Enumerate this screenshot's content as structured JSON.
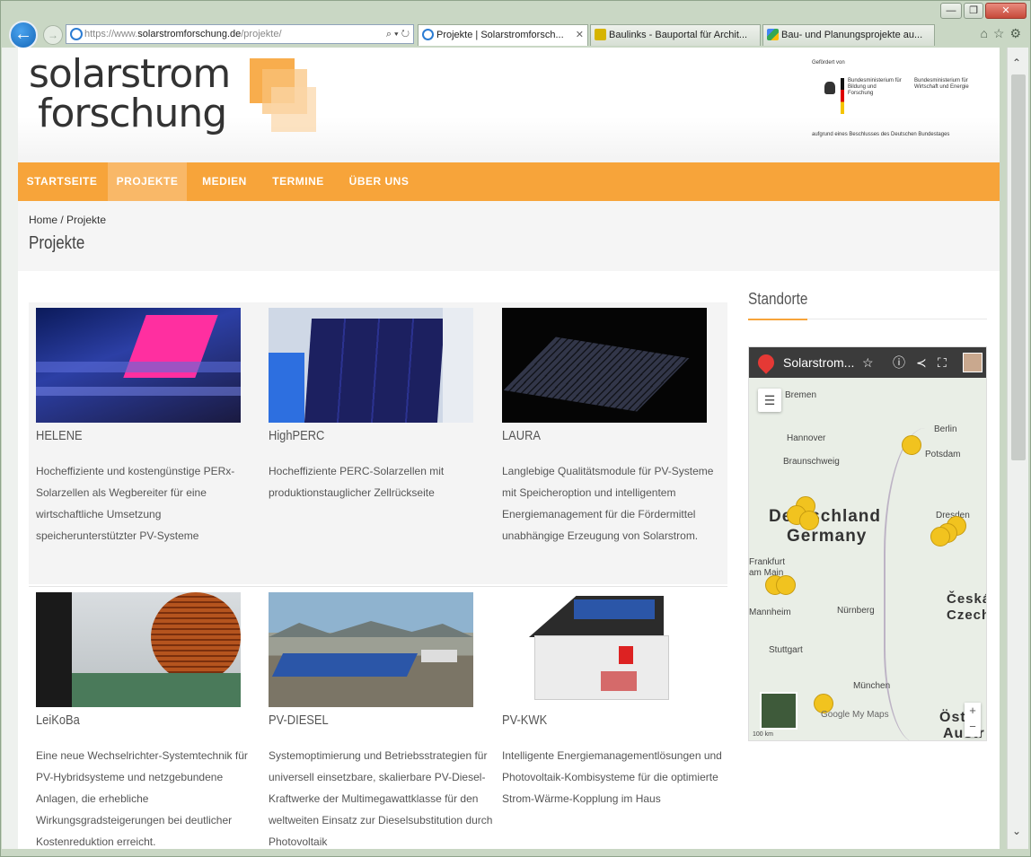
{
  "browser": {
    "address": {
      "scheme": "https://www.",
      "host": "solarstromforschung.de",
      "path": "/projekte/",
      "tools": "⌕ ▾ ↻"
    },
    "tabs": [
      {
        "label": "Projekte | Solarstromforsch...",
        "close": "✕",
        "color": "#2b7cd3"
      },
      {
        "label": "Baulinks - Bauportal für Archit...",
        "color": "#d6b400"
      },
      {
        "label": "Bau- und Planungsprojekte au...",
        "color": "#3c7a2e"
      }
    ],
    "window_buttons": {
      "minimize": "—",
      "restore": "❐",
      "close": "✕"
    },
    "back": "←",
    "forward": "→",
    "right_icons": "⌂☆⚙"
  },
  "header": {
    "logo_line1": "solarstrom",
    "logo_line2": "forschung",
    "sponsor": {
      "caption": "Gefördert von",
      "ministry1": "Bundesministerium für Bildung und Forschung",
      "ministry2": "Bundesministerium für Wirtschaft und Energie",
      "note": "aufgrund eines Beschlusses des Deutschen Bundestages"
    }
  },
  "nav": {
    "items": [
      {
        "label": "STARTSEITE"
      },
      {
        "label": "PROJEKTE"
      },
      {
        "label": "MEDIEN"
      },
      {
        "label": "TERMINE"
      },
      {
        "label": "ÜBER UNS"
      }
    ]
  },
  "page": {
    "breadcrumb": "Home / Projekte",
    "title": "Projekte"
  },
  "projects": [
    {
      "title": "HELENE",
      "desc": "Hocheffiziente und kostengünstige PERx-Solarzellen als Wegbereiter für eine wirtschaftliche Umsetzung speicherunterstützter PV-Systeme"
    },
    {
      "title": "HighPERC",
      "desc": "Hocheffiziente PERC-Solarzellen mit produktionstauglicher Zellrückseite"
    },
    {
      "title": "LAURA",
      "desc": "Langlebige Qualitätsmodule für PV-Systeme mit Speicheroption und intelligentem Energiemanagement für die Fördermittel unabhängige Erzeugung von Solarstrom."
    },
    {
      "title": "LeiKoBa",
      "desc": "Eine neue Wechselrichter-Systemtechnik für PV-Hybridsysteme und netzgebundene Anlagen, die erhebliche Wirkungsgradsteigerungen bei deutlicher Kostenreduktion erreicht."
    },
    {
      "title": "PV-DIESEL",
      "desc": "Systemoptimierung und Betriebsstrategien für universell einsetzbare, skalierbare PV-Diesel-Kraftwerke der Multimegawattklasse für den weltweiten Einsatz zur Dieselsubstitution durch Photovoltaik"
    },
    {
      "title": "PV-KWK",
      "desc": "Intelligente Energiemanagementlösungen und Photovoltaik-Kombisysteme für die optimierte Strom-Wärme-Kopplung im Haus"
    }
  ],
  "sidebar": {
    "title": "Standorte",
    "map": {
      "title": "Solarstrom...",
      "icons": {
        "star": "☆",
        "info": "ⓘ",
        "share": "≺",
        "fullscreen": "⛶",
        "legend": "☰"
      },
      "labels": {
        "bremen": "Bremen",
        "hannover": "Hannover",
        "braunschweig": "Braunschweig",
        "berlin": "Berlin",
        "potsdam": "Potsdam",
        "dresden": "Dresden",
        "frankfurt": "Frankfurt am Main",
        "mannheim": "Mannheim",
        "nuernberg": "Nürnberg",
        "stuttgart": "Stuttgart",
        "muenchen": "München",
        "deutschland": "Deutschland",
        "germany": "Germany",
        "ceska": "Česká",
        "czech": "Czech",
        "oster": "Öster",
        "austr": "Austr",
        "google": "Google My Maps",
        "scale": "100 km",
        "zoom_in": "+",
        "zoom_out": "−"
      }
    }
  },
  "colors": {
    "accent": "#f7a43a",
    "nav_active": "#f9b868",
    "pin": "#f1c31f"
  }
}
